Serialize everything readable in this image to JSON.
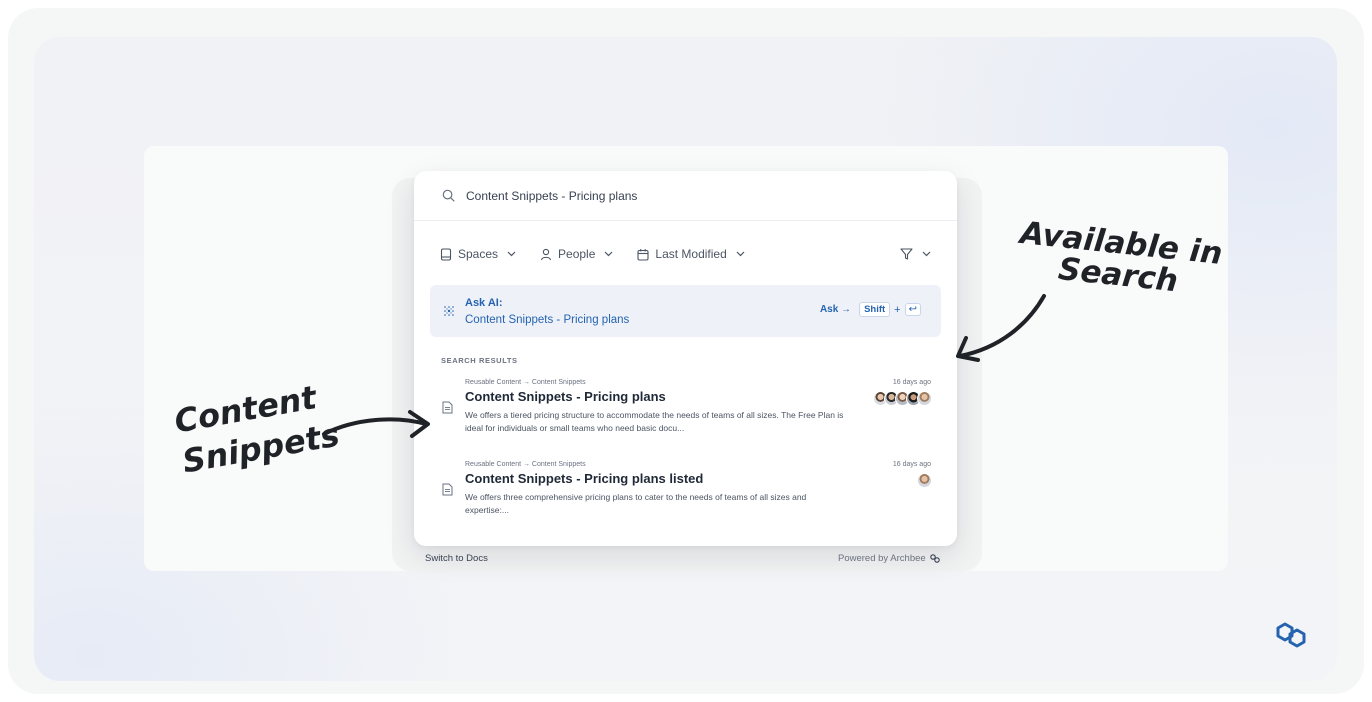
{
  "search": {
    "query": "Content Snippets - Pricing plans"
  },
  "filters": [
    {
      "label": "Spaces",
      "icon": "book-icon"
    },
    {
      "label": "People",
      "icon": "person-icon"
    },
    {
      "label": "Last Modified",
      "icon": "calendar-icon"
    }
  ],
  "filter_funnel": {
    "icon": "funnel-icon"
  },
  "ask_ai": {
    "label": "Ask AI:",
    "query": "Content Snippets - Pricing plans",
    "shortcut_action": "Ask →",
    "shortcut_key": "Shift",
    "shortcut_plus": "+",
    "shortcut_enter": "↩"
  },
  "results_section": {
    "label": "SEARCH RESULTS"
  },
  "results": [
    {
      "breadcrumb": "Reusable Content → Content Snippets",
      "time_ago": "16 days ago",
      "title": "Content Snippets - Pricing plans",
      "snippet": "We offers a tiered pricing structure to accommodate the needs of teams of all sizes. The Free Plan is ideal for individuals or small teams who need basic docu..."
    },
    {
      "breadcrumb": "Reusable Content → Content Snippets",
      "time_ago": "16 days ago",
      "title": "Content Snippets - Pricing plans listed",
      "snippet": "We offers three comprehensive pricing plans to cater to the needs of teams of all sizes and expertise:..."
    }
  ],
  "footer": {
    "switch_label": "Switch to Docs",
    "powered_label": "Powered by Archbee"
  },
  "annotations": {
    "content_line1": "Content",
    "content_line2": "Snippets",
    "available_line1": "Available in",
    "available_line2": "Search"
  },
  "colors": {
    "accent": "#2563b0",
    "ask_ai_bg": "#eef2f8",
    "text": "#1f2937",
    "brand_logo": "#2563b0"
  }
}
